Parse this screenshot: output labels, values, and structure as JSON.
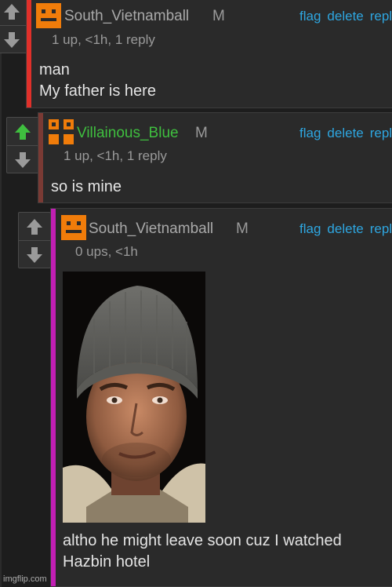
{
  "comments": [
    {
      "username": "South_Vietnamball",
      "username_color": "#a9a9a9",
      "accent_color": "#e0302a",
      "badge": "M",
      "actions": [
        "flag",
        "delete",
        "reply"
      ],
      "meta": "1 up, <1h, 1 reply",
      "body_lines": [
        "man",
        "My father is here"
      ],
      "upvoted": false
    },
    {
      "username": "Villainous_Blue",
      "username_color": "#3fbf3f",
      "accent_color": "#7a3a34",
      "badge": "M",
      "actions": [
        "flag",
        "delete",
        "reply"
      ],
      "meta": "1 up, <1h, 1 reply",
      "body_lines": [
        "so is mine"
      ],
      "upvoted": true
    },
    {
      "username": "South_Vietnamball",
      "username_color": "#a9a9a9",
      "accent_color": "#c21fb4",
      "badge": "M",
      "actions": [
        "flag",
        "delete",
        "reply"
      ],
      "meta": "0 ups, <1h",
      "body_lines": [
        "altho he might leave soon cuz I watched",
        "Hazbin hotel"
      ],
      "upvoted": false
    }
  ],
  "colors": {
    "link": "#2ea6e0",
    "upvote_active": "#3fbf3f",
    "vote_inactive": "#9a9a9a",
    "avatar_orange": "#f07c0a"
  },
  "watermark": "imgflip.com"
}
